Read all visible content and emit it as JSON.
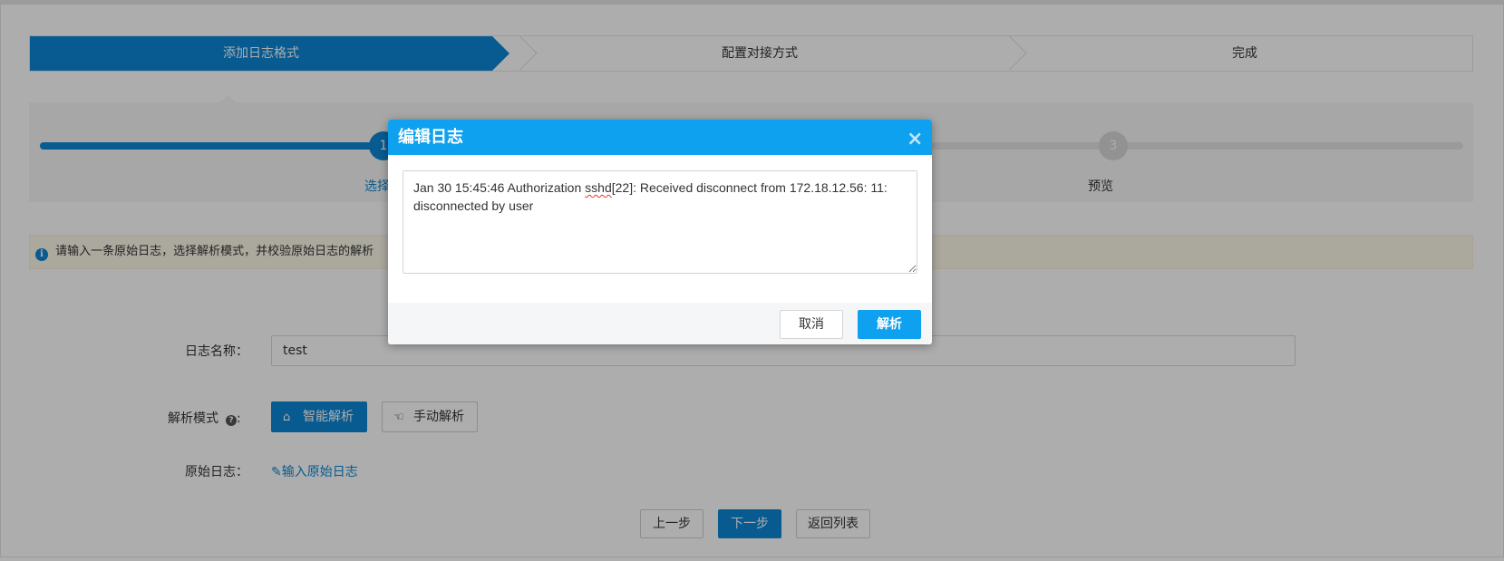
{
  "steps": [
    "添加日志格式",
    "配置对接方式",
    "完成"
  ],
  "substeps": {
    "first_number": "1",
    "first_label": "选择",
    "third_number": "3",
    "third_label": "预览"
  },
  "info": {
    "text": "请输入一条原始日志，选择解析模式，并校验原始日志的解析"
  },
  "form": {
    "name_label": "日志名称：",
    "name_value": "test",
    "mode_label": "解析模式",
    "mode_colon": ":",
    "smart_mode": "智能解析",
    "manual_mode": "手动解析",
    "raw_label": "原始日志：",
    "raw_link": "输入原始日志"
  },
  "buttons": {
    "prev": "上一步",
    "next": "下一步",
    "back": "返回列表"
  },
  "modal": {
    "title": "编辑日志",
    "close": "×",
    "log_before": "Jan 30 15:45:46 Authorization ",
    "log_squiggle": "sshd",
    "log_after": "[22]: Received disconnect from 172.18.12.56: 11: disconnected by user",
    "cancel": "取消",
    "parse": "解析"
  },
  "colors": {
    "primary": "#0c86d6",
    "modal_header": "#0ea1f0",
    "info_bg": "#fcf8e9"
  },
  "icons": {
    "info": "info-circle-icon",
    "help": "question-circle-icon",
    "smart": "robot-icon",
    "manual": "hand-pointer-icon",
    "edit": "pencil-icon",
    "close": "close-icon"
  }
}
